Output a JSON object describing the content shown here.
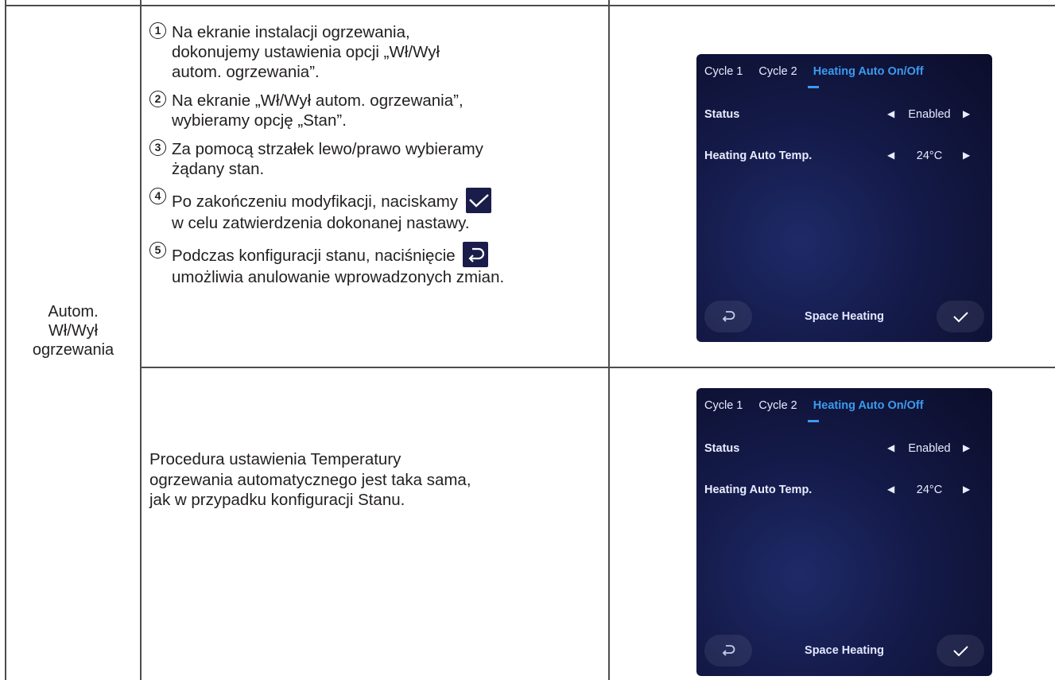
{
  "label": [
    "Autom.",
    "Wł/Wył",
    "ogrzewania"
  ],
  "steps": [
    {
      "num": "1",
      "lines": [
        "Na ekranie instalacji ogrzewania,",
        "dokonujemy ustawienia opcji „Wł/Wył",
        "autom. ogrzewania”."
      ]
    },
    {
      "num": "2",
      "lines": [
        "Na ekranie „Wł/Wył autom. ogrzewania”,",
        "wybieramy opcję „Stan”."
      ]
    },
    {
      "num": "3",
      "lines": [
        "Za pomocą strzałek lewo/prawo wybieramy",
        "żądany stan."
      ]
    },
    {
      "num": "4",
      "lines": [
        "Po zakończeniu modyfikacji, naciskamy",
        "w celu zatwierdzenia dokonanej nastawy."
      ]
    },
    {
      "num": "5",
      "lines": [
        "Podczas konfiguracji stanu, naciśnięcie",
        "umożliwia anulowanie wprowadzonych zmian."
      ]
    }
  ],
  "note": [
    "Procedura ustawienia Temperatury",
    "ogrzewania automatycznego jest taka sama,",
    "jak w przypadku konfiguracji Stanu."
  ],
  "screen": {
    "tabs": [
      "Cycle 1",
      "Cycle 2",
      "Heating Auto On/Off"
    ],
    "status_label": "Status",
    "status_value": "Enabled",
    "temp_label": "Heating Auto Temp.",
    "temp_value": "24°C",
    "footer_title": "Space Heating",
    "left_arrow": "◀",
    "right_arrow": "▶"
  },
  "colors": {
    "accent": "#3a9bf0",
    "screen_bg": "#141a48",
    "border": "#4d4d4d"
  }
}
